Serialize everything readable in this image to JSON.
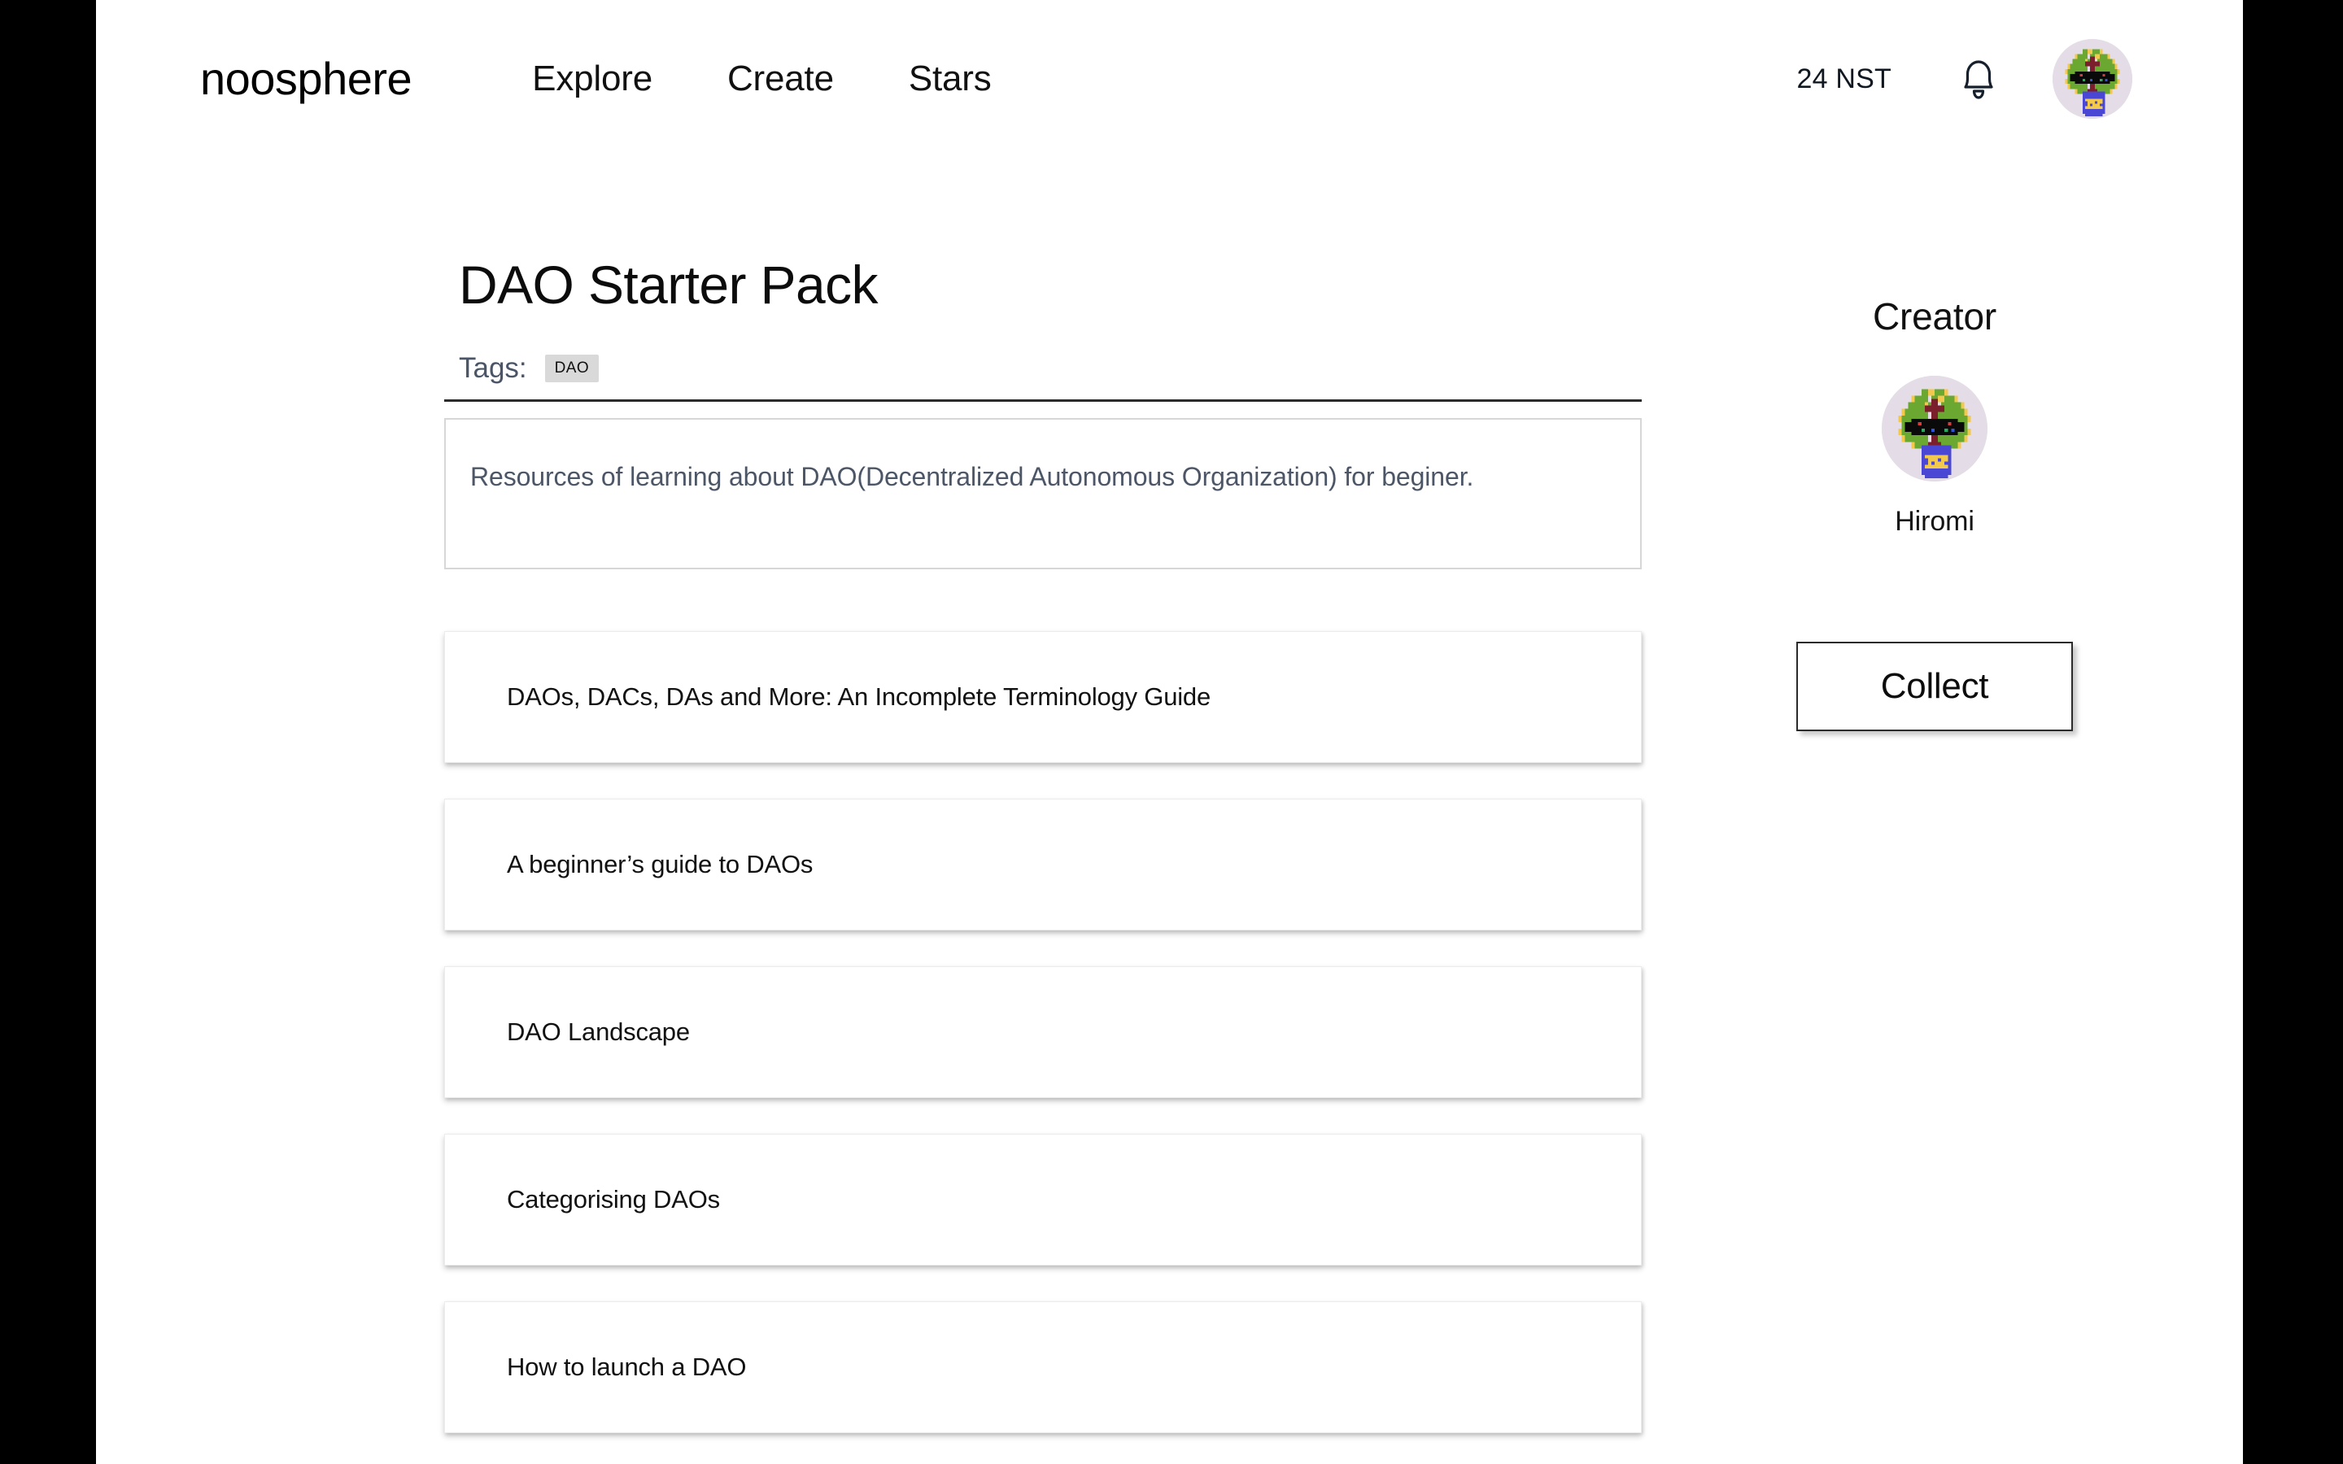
{
  "navbar": {
    "brand": "noosphere",
    "links": [
      {
        "label": "Explore",
        "name": "nav-link-explore"
      },
      {
        "label": "Create",
        "name": "nav-link-create"
      },
      {
        "label": "Stars",
        "name": "nav-link-stars"
      }
    ],
    "balance": "24 NST",
    "bell_icon": "bell-icon",
    "avatar_icon": "user-avatar"
  },
  "main": {
    "title": "DAO Starter Pack",
    "tags_label": "Tags:",
    "tags": [
      "DAO"
    ],
    "description": "Resources of learning about DAO(Decentralized Autonomous Organization) for beginer.",
    "resources": [
      {
        "title": "DAOs, DACs, DAs and More: An Incomplete Terminology Guide"
      },
      {
        "title": "A beginner’s guide to DAOs"
      },
      {
        "title": "DAO Landscape"
      },
      {
        "title": "Categorising DAOs"
      },
      {
        "title": "How to launch a DAO"
      }
    ]
  },
  "sidebar": {
    "creator_heading": "Creator",
    "creator_name": "Hiromi",
    "creator_avatar_icon": "creator-avatar",
    "collect_label": "Collect"
  },
  "colors": {
    "page_background": "#ffffff",
    "letterbox": "#000000",
    "text_primary": "#111111",
    "text_muted": "#4a5568",
    "tag_chip_background": "#d9d9d9",
    "divider": "#2b2b2b",
    "avatar_background": "#e4dce6",
    "avatar_foliage": "#6aa832",
    "avatar_blossom": "#f2c94c",
    "avatar_pot": "#4a47d4",
    "avatar_trunk": "#7a1f2b",
    "button_border": "#2b2b2b"
  }
}
